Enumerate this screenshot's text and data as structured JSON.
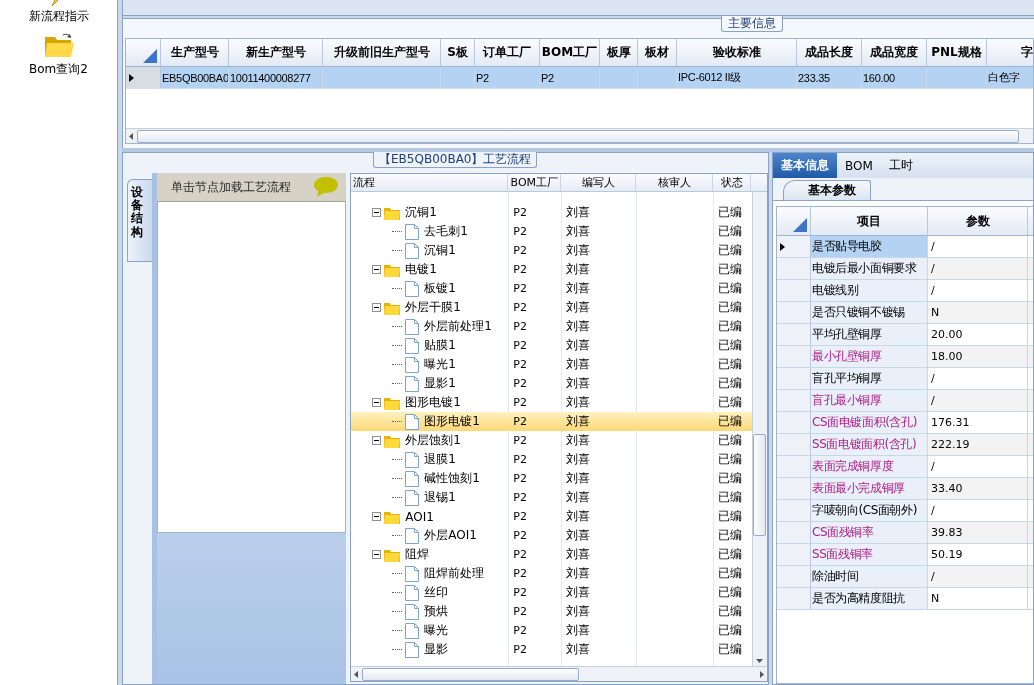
{
  "sidebar": {
    "items": [
      {
        "label": "新流程指示",
        "kind": "flash"
      },
      {
        "label": "Bom查询2",
        "kind": "folder"
      }
    ]
  },
  "main_info": {
    "title": "主要信息",
    "columns": [
      "生产型号",
      "新生产型号",
      "升级前旧生产型号",
      "S板",
      "订单工厂",
      "BOM工厂",
      "板厚",
      "板材",
      "验收标准",
      "成品长度",
      "成品宽度",
      "PNL规格",
      "字"
    ],
    "rows": [
      {
        "selected": true,
        "cells": [
          "EB5QB00BA0",
          "10011400008277",
          null,
          null,
          "P2",
          "P2",
          null,
          null,
          "IPC-6012 II级",
          "233.35",
          "160.00",
          null,
          "白色字"
        ]
      }
    ]
  },
  "process_panel": {
    "title": "【EB5QB00BA0】工艺流程",
    "side_tab": "设备结构",
    "node_hint": "单击节点加载工艺流程",
    "columns": [
      "流程",
      "BOM工厂",
      "编写人",
      "核审人",
      "状态"
    ],
    "tree": [
      {
        "name": "沉铜1",
        "expanded": true,
        "selected": false,
        "bom": "P2",
        "writer": "刘喜",
        "status": "已编",
        "children": [
          {
            "name": "去毛刺1",
            "selected": false,
            "bom": "P2",
            "writer": "刘喜",
            "status": "已编"
          },
          {
            "name": "沉铜1",
            "selected": false,
            "bom": "P2",
            "writer": "刘喜",
            "status": "已编"
          }
        ]
      },
      {
        "name": "电镀1",
        "expanded": true,
        "selected": false,
        "bom": "P2",
        "writer": "刘喜",
        "status": "已编",
        "children": [
          {
            "name": "板镀1",
            "selected": false,
            "bom": "P2",
            "writer": "刘喜",
            "status": "已编"
          }
        ]
      },
      {
        "name": "外层干膜1",
        "expanded": true,
        "selected": false,
        "bom": "P2",
        "writer": "刘喜",
        "status": "已编",
        "children": [
          {
            "name": "外层前处理1",
            "selected": false,
            "bom": "P2",
            "writer": "刘喜",
            "status": "已编"
          },
          {
            "name": "贴膜1",
            "selected": false,
            "bom": "P2",
            "writer": "刘喜",
            "status": "已编"
          },
          {
            "name": "曝光1",
            "selected": false,
            "bom": "P2",
            "writer": "刘喜",
            "status": "已编"
          },
          {
            "name": "显影1",
            "selected": false,
            "bom": "P2",
            "writer": "刘喜",
            "status": "已编"
          }
        ]
      },
      {
        "name": "图形电镀1",
        "expanded": true,
        "selected": false,
        "bom": "P2",
        "writer": "刘喜",
        "status": "已编",
        "children": [
          {
            "name": "图形电镀1",
            "selected": true,
            "bom": "P2",
            "writer": "刘喜",
            "status": "已编"
          }
        ]
      },
      {
        "name": "外层蚀刻1",
        "expanded": true,
        "selected": false,
        "bom": "P2",
        "writer": "刘喜",
        "status": "已编",
        "children": [
          {
            "name": "退膜1",
            "selected": false,
            "bom": "P2",
            "writer": "刘喜",
            "status": "已编"
          },
          {
            "name": "碱性蚀刻1",
            "selected": false,
            "bom": "P2",
            "writer": "刘喜",
            "status": "已编"
          },
          {
            "name": "退锡1",
            "selected": false,
            "bom": "P2",
            "writer": "刘喜",
            "status": "已编"
          }
        ]
      },
      {
        "name": "AOI1",
        "expanded": true,
        "selected": false,
        "bom": "P2",
        "writer": "刘喜",
        "status": "已编",
        "children": [
          {
            "name": "外层AOI1",
            "selected": false,
            "bom": "P2",
            "writer": "刘喜",
            "status": "已编"
          }
        ]
      },
      {
        "name": "阻焊",
        "expanded": true,
        "selected": false,
        "bom": "P2",
        "writer": "刘喜",
        "status": "已编",
        "children": [
          {
            "name": "阻焊前处理",
            "selected": false,
            "bom": "P2",
            "writer": "刘喜",
            "status": "已编"
          },
          {
            "name": "丝印",
            "selected": false,
            "bom": "P2",
            "writer": "刘喜",
            "status": "已编"
          },
          {
            "name": "预烘",
            "selected": false,
            "bom": "P2",
            "writer": "刘喜",
            "status": "已编"
          },
          {
            "name": "曝光",
            "selected": false,
            "bom": "P2",
            "writer": "刘喜",
            "status": "已编"
          },
          {
            "name": "显影",
            "selected": false,
            "bom": "P2",
            "writer": "刘喜",
            "status": "已编"
          }
        ]
      }
    ]
  },
  "detail_panel": {
    "tabs": [
      {
        "label": "基本信息",
        "selected": true
      },
      {
        "label": "BOM",
        "selected": false
      },
      {
        "label": "工时",
        "selected": false
      }
    ],
    "sub_tabs": [
      {
        "label": "基本参数",
        "selected": true
      }
    ],
    "columns": [
      "项目",
      "参数"
    ],
    "rows": [
      {
        "item": "是否贴导电胶",
        "value": "/",
        "emphasized": false,
        "selected": true
      },
      {
        "item": "电镀后最小面铜要求",
        "value": "/",
        "emphasized": false,
        "selected": false
      },
      {
        "item": "电镀线别",
        "value": "/",
        "emphasized": false,
        "selected": false
      },
      {
        "item": "是否只镀铜不镀锡",
        "value": "N",
        "emphasized": false,
        "selected": false
      },
      {
        "item": "平均孔壁铜厚",
        "value": "20.00",
        "emphasized": false,
        "selected": false
      },
      {
        "item": "最小孔壁铜厚",
        "value": "18.00",
        "emphasized": true,
        "selected": false
      },
      {
        "item": "盲孔平均铜厚",
        "value": "/",
        "emphasized": false,
        "selected": false
      },
      {
        "item": "盲孔最小铜厚",
        "value": "/",
        "emphasized": true,
        "selected": false
      },
      {
        "item": "CS面电镀面积(含孔)",
        "value": "176.31",
        "emphasized": true,
        "selected": false
      },
      {
        "item": "SS面电镀面积(含孔)",
        "value": "222.19",
        "emphasized": true,
        "selected": false
      },
      {
        "item": "表面完成铜厚度",
        "value": "/",
        "emphasized": true,
        "selected": false
      },
      {
        "item": "表面最小完成铜厚",
        "value": "33.40",
        "emphasized": true,
        "selected": false
      },
      {
        "item": "字唛朝向(CS面朝外)",
        "value": "/",
        "emphasized": false,
        "selected": false
      },
      {
        "item": "CS面残铜率",
        "value": "39.83",
        "emphasized": true,
        "selected": false
      },
      {
        "item": "SS面残铜率",
        "value": "50.19",
        "emphasized": true,
        "selected": false
      },
      {
        "item": "除油时间",
        "value": "/",
        "emphasized": false,
        "selected": false
      },
      {
        "item": "是否为高精度阻抗",
        "value": "N",
        "emphasized": false,
        "selected": false
      }
    ]
  }
}
